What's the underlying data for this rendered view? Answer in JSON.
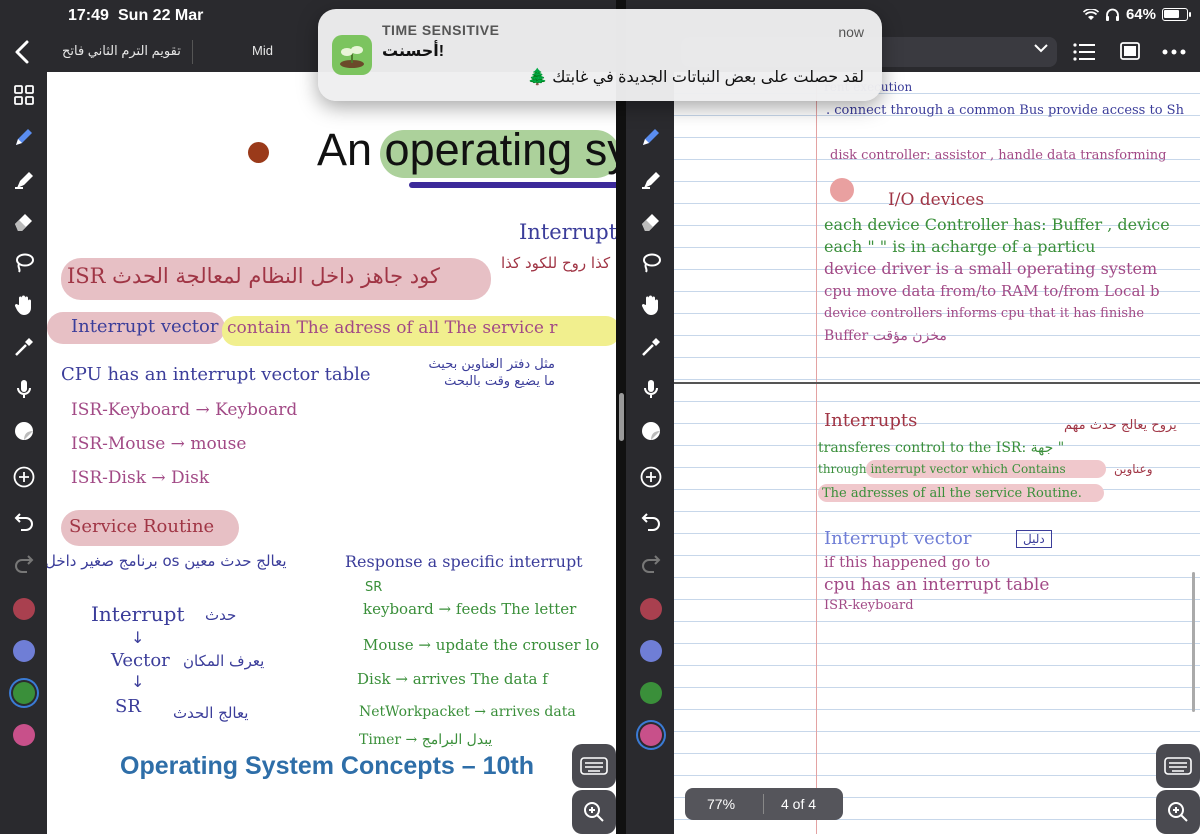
{
  "status_bar": {
    "time": "17:49",
    "date": "Sun 22 Mar",
    "battery": "64%"
  },
  "notification": {
    "app": "TIME SENSITIVE",
    "time": "now",
    "title": "أحسنت!",
    "body": "لقد حصلت على بعض النباتات الجديدة في غابتك 🌲"
  },
  "left_app": {
    "title": "تقويم الترم الثاني فاتح",
    "title2": "Mid",
    "slide": {
      "heading": "An operating sy",
      "footer": "Operating System Concepts – 10th",
      "notes": {
        "interrupt_top": "Interrupt",
        "arabic_top": "كذا روح للكود كذا",
        "isr_line": "ISR كود جاهز داخل النظام لمعالجة الحدث",
        "vector_label": "Interrupt vector",
        "vector_desc": "contain The adress of all The service r",
        "cpu_line": "CPU has an interrupt vector table",
        "arabic_table": "مثل دفتر العناوين بحيث ما يضيع وقت بالبحث",
        "isr_keyboard": "ISR-Keyboard → Keyboard",
        "isr_mouse": "ISR-Mouse → mouse",
        "isr_disk": "ISR-Disk → Disk",
        "service_routine": "Service Routine",
        "arabic_program": "برنامج صغير داخل os يعالج حدث معين",
        "response_line": "Response a specific interrupt",
        "sr_label": "SR",
        "flow_interrupt": "Interrupt",
        "flow_interrupt_ar": "حدث",
        "flow_vector": "Vector",
        "flow_vector_ar": "يعرف المكان",
        "flow_sr": "SR",
        "flow_sr_ar": "يعالج الحدث",
        "sr_keyboard": "keyboard → feeds The letter",
        "sr_mouse": "Mouse → update the crouser lo",
        "sr_disk": "Disk → arrives The data f",
        "sr_network": "NetWorkpacket → arrives data",
        "sr_timer": "Timer → يبدل البرامج"
      }
    }
  },
  "right_app": {
    "page_zoom": "77%",
    "page_indicator": "4 of 4",
    "notes": {
      "line_top1": "rent execution",
      "line_top2": ". connect through a common Bus provide access to Sh",
      "disk_controller": "disk controller: assistor , handle data transforming",
      "io_heading": "I/O devices",
      "io1": "each device Controller has: Buffer , device",
      "io2": "each \"    \" is in acharge of a particu",
      "io3": "device driver is a small operating system",
      "io4": "cpu move data from/to RAM to/from Local b",
      "io5": "device controllers informs cpu that it has finishe",
      "io6": "Buffer مخزن مؤقت",
      "int_heading": "Interrupts",
      "int_ar": "يروح يعالج حدث مهم",
      "int1": "transferes control to the ISR: جهة \"",
      "int2": "through interrupt vector which Contains",
      "int2_ar": "وعناوين",
      "int3": "The adresses of all the service Routine.",
      "iv_heading": "Interrupt vector",
      "iv_tag": "دليل",
      "iv1": "if this happened go to",
      "iv2": "cpu has an interrupt table",
      "iv3": "ISR-keyboard"
    }
  },
  "colors": {
    "swatch_1": "#a9404f",
    "swatch_2": "#6f7ed6",
    "swatch_3": "#3a8f3a",
    "swatch_4": "#c8508a",
    "selected_swatch": "#3a7bd5"
  }
}
